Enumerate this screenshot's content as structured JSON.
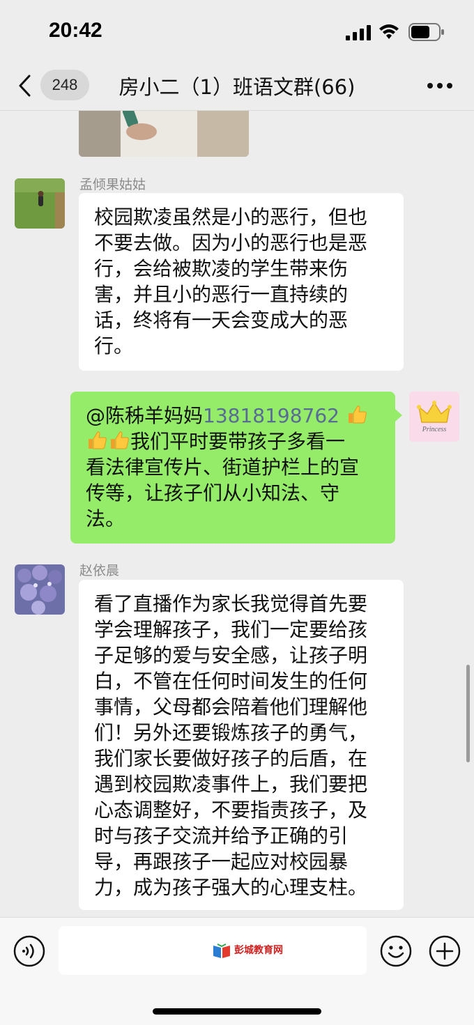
{
  "status_bar": {
    "time": "20:42"
  },
  "nav": {
    "unread_count": "248",
    "title": "房小二（1）班语文群(66)"
  },
  "messages": [
    {
      "sender": "孟倾果姑姑",
      "direction": "incoming",
      "lines": [
        "校园欺凌虽然是小的恶行，但也",
        "不要去做。因为小的恶行也是恶",
        "行，会给被欺凌的学生带来伤",
        "害，并且小的恶行一直持续的",
        "话，终将有一天会变成大的恶",
        "行。"
      ]
    },
    {
      "direction": "outgoing",
      "mention": "@陈秭羊妈妈",
      "phone": "13818198762",
      "line2": "我们平时要带孩子多看一",
      "lines": [
        "看法律宣传片、街道护栏上的宣",
        "传等，让孩子们从小知法、守",
        "法。"
      ],
      "avatar_text": "Princess"
    },
    {
      "sender": "赵依晨",
      "direction": "incoming",
      "lines": [
        "看了直播作为家长我觉得首先要",
        "学会理解孩子，我们一定要给孩",
        "子足够的爱与安全感，让孩子明",
        "白，不管在任何时间发生的任何",
        "事情，父母都会陪着他们理解他",
        "们！另外还要锻炼孩子的勇气，",
        "我们家长要做好孩子的后盾，在",
        "遇到校园欺凌事件上，我们要把",
        "心态调整好，不要指责孩子，及",
        "时与孩子交流并给予正确的引",
        "导，再跟孩子一起应对校园暴",
        "力，成为孩子强大的心理支柱。"
      ]
    }
  ],
  "input_bar": {
    "watermark": "彭城教育网"
  },
  "icons": {
    "back": "chevron-left-icon",
    "more": "more-icon",
    "voice": "voice-icon",
    "emoji": "emoji-icon",
    "add": "plus-icon",
    "thumbs": "thumbs-up-icon"
  },
  "colors": {
    "outgoing_bubble": "#95ec69",
    "incoming_bubble": "#ffffff",
    "background": "#ededed",
    "link": "#576b95"
  }
}
